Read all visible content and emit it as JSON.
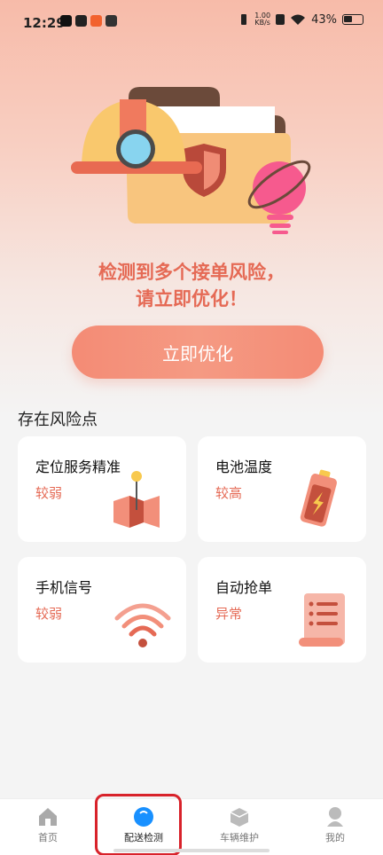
{
  "status_bar": {
    "time": "12:29",
    "net_speed_value": "1.00",
    "net_speed_unit": "KB/s",
    "battery": "43%"
  },
  "hero": {
    "headline_line1": "检测到多个接单风险，",
    "headline_line2": "请立即优化！"
  },
  "optimize_button": "立即优化",
  "section_title": "存在风险点",
  "risk_cards": [
    {
      "title": "定位服务精准",
      "status": "较弱",
      "icon": "map-pin-icon"
    },
    {
      "title": "电池温度",
      "status": "较高",
      "icon": "battery-icon"
    },
    {
      "title": "手机信号",
      "status": "较弱",
      "icon": "wifi-signal-icon"
    },
    {
      "title": "自动抢单",
      "status": "异常",
      "icon": "scroll-document-icon"
    }
  ],
  "tabbar": [
    {
      "label": "首页",
      "icon": "home-icon",
      "active": false
    },
    {
      "label": "配送检测",
      "icon": "detect-icon",
      "active": true
    },
    {
      "label": "车辆维护",
      "icon": "box-icon",
      "active": false
    },
    {
      "label": "我的",
      "icon": "profile-icon",
      "active": false
    }
  ],
  "colors": {
    "accent": "#e56a55",
    "button_gradient": "#f48b75",
    "active_tab": "#1890ff",
    "highlight": "#d8222a"
  }
}
